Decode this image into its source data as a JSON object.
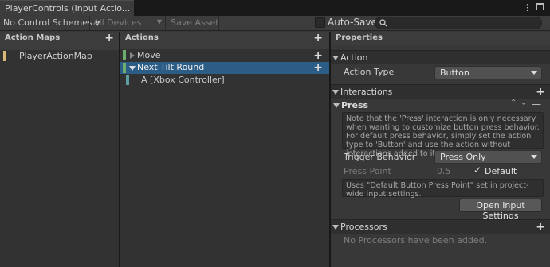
{
  "window": {
    "title": "PlayerControls (Input Actio..."
  },
  "toolbar": {
    "control_schemes": "No Control Schemes",
    "devices": "All Devices",
    "save_asset": "Save Asset",
    "auto_save": "Auto-Save",
    "search_placeholder": ""
  },
  "action_maps": {
    "header": "Action Maps",
    "items": [
      {
        "label": "PlayerActionMap",
        "color": "#d8b977"
      }
    ]
  },
  "actions": {
    "header": "Actions",
    "items": [
      {
        "label": "Move",
        "color": "#6dae6f"
      },
      {
        "label": "Next Tilt Round",
        "color": "#6dae6f",
        "selected": true
      }
    ],
    "bindings": [
      {
        "label": "A [Xbox Controller]",
        "color": "#5e9ea0"
      }
    ]
  },
  "properties": {
    "header": "Properties",
    "action_section": "Action",
    "action_type_label": "Action Type",
    "action_type_value": "Button",
    "interactions_section": "Interactions",
    "press_section": "Press",
    "press_help": "Note that the 'Press' interaction is only necessary when wanting to customize button press behavior. For default press behavior, simply set the action type to 'Button' and use the action without interactions added to it.",
    "trigger_behavior_label": "Trigger Behavior",
    "trigger_behavior_value": "Press Only",
    "press_point_label": "Press Point",
    "press_point_value": "0.5",
    "default_label": "Default",
    "press_point_help": "Uses \"Default Button Press Point\" set in project-wide input settings.",
    "open_input_settings": "Open Input Settings",
    "processors_section": "Processors",
    "processors_empty": "No Processors have been added."
  }
}
